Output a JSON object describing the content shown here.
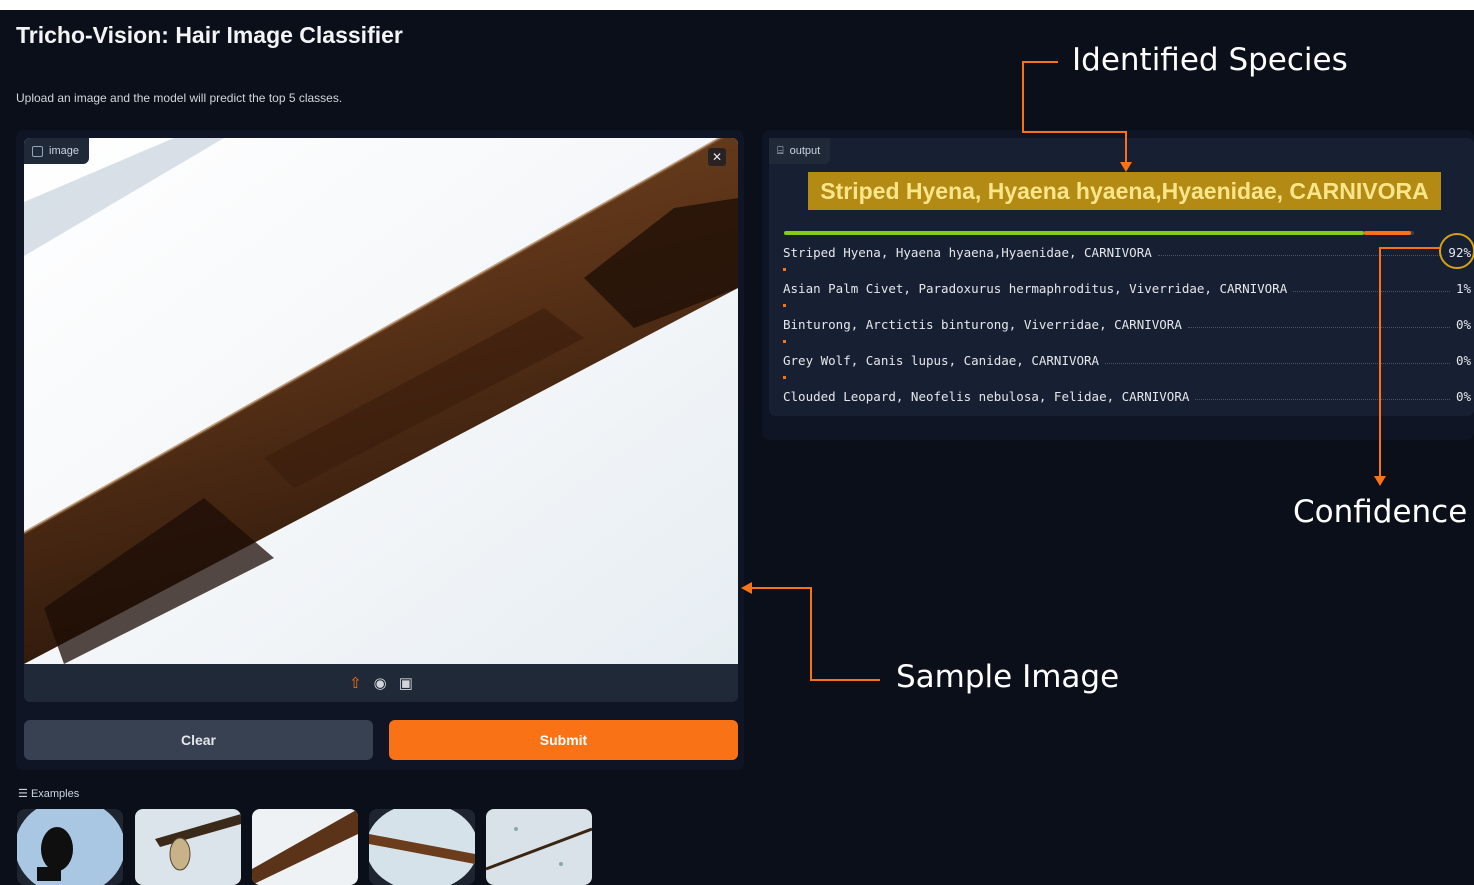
{
  "app": {
    "title": "Tricho-Vision: Hair Image Classifier",
    "description": "Upload an image and the model will predict the top 5 classes."
  },
  "input": {
    "label": "image",
    "close_icon": "close-icon",
    "tools": [
      "upload-icon",
      "camera-icon",
      "clipboard-icon"
    ]
  },
  "buttons": {
    "clear": "Clear",
    "submit": "Submit"
  },
  "examples": {
    "label": "Examples",
    "count": 5
  },
  "output": {
    "label": "output",
    "top_class": "Striped Hyena, Hyaena hyaena,Hyaenidae, CARNIVORA",
    "top_confidence": 0.92,
    "predictions": [
      {
        "label": "Striped Hyena, Hyaena hyaena,Hyaenidae, CARNIVORA",
        "confidence": "92%"
      },
      {
        "label": "Asian Palm Civet, Paradoxurus hermaphroditus, Viverridae, CARNIVORA",
        "confidence": "1%"
      },
      {
        "label": "Binturong, Arctictis binturong, Viverridae, CARNIVORA",
        "confidence": "0%"
      },
      {
        "label": "Grey Wolf, Canis lupus, Canidae, CARNIVORA",
        "confidence": "0%"
      },
      {
        "label": "Clouded Leopard, Neofelis nebulosa, Felidae, CARNIVORA",
        "confidence": "0%"
      }
    ]
  },
  "annotations": {
    "identified_species": "Identified Species",
    "confidence": "Confidence",
    "sample_image": "Sample Image"
  },
  "colors": {
    "accent": "#f97316",
    "background": "#0b0f19",
    "highlight": "#b38a14",
    "bar": "#84cc16"
  }
}
